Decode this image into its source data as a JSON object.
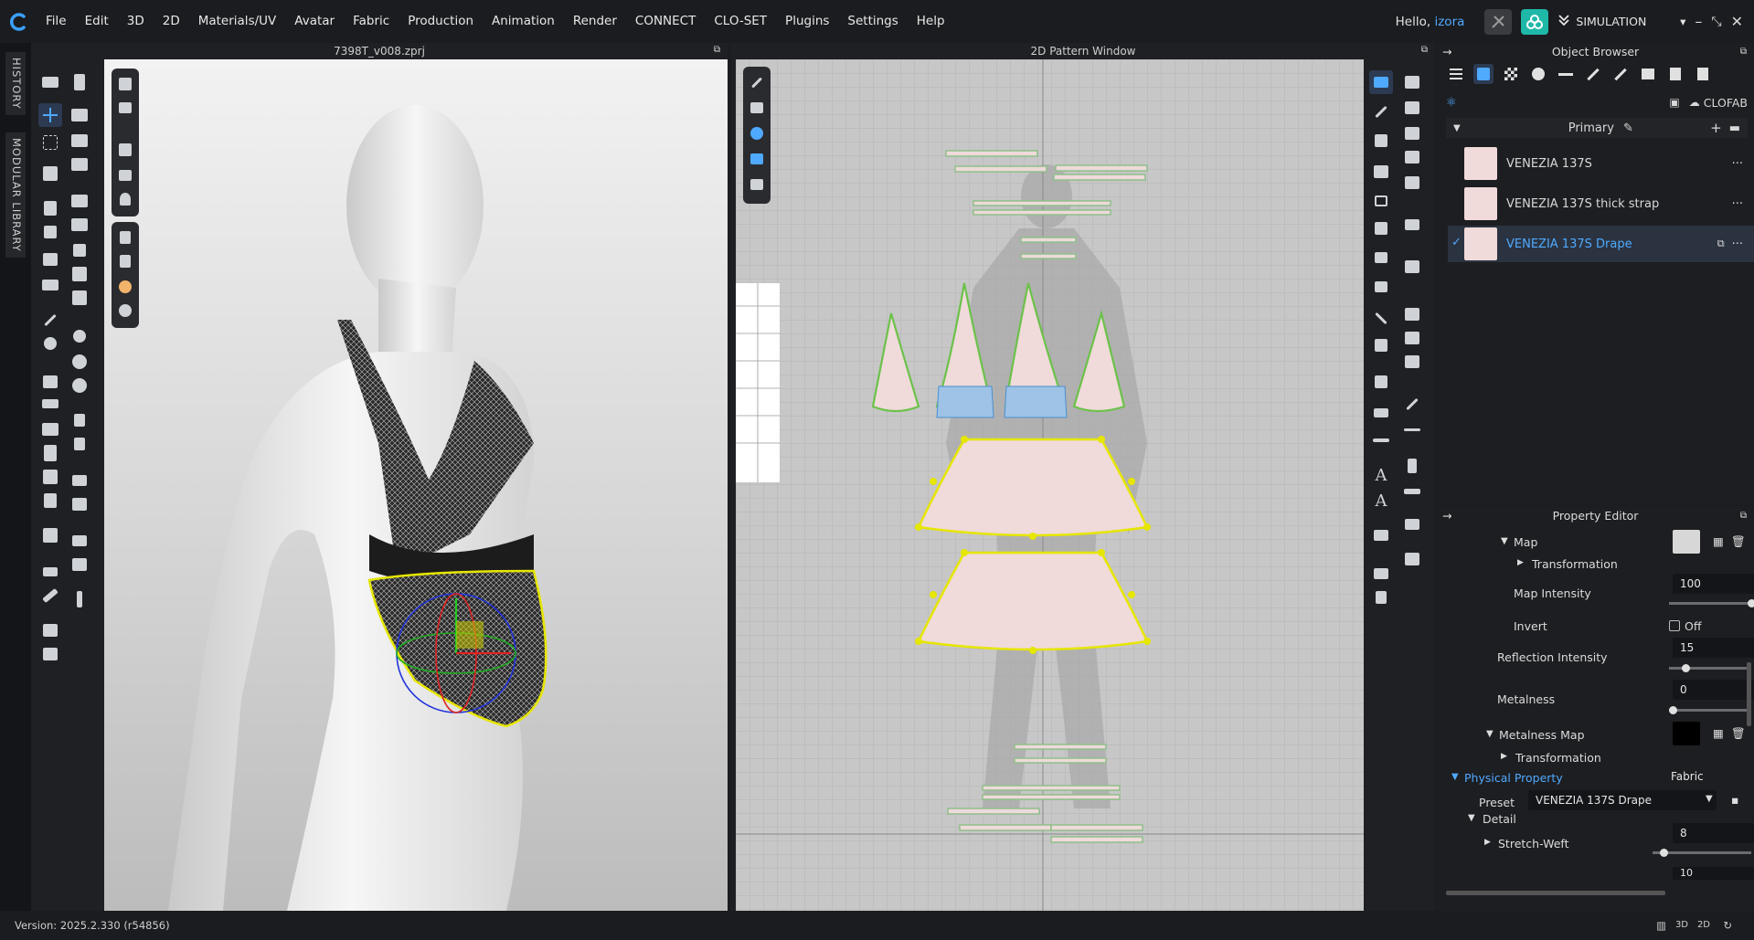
{
  "menubar": {
    "items": [
      "File",
      "Edit",
      "3D",
      "2D",
      "Materials/UV",
      "Avatar",
      "Fabric",
      "Production",
      "Animation",
      "Render",
      "CONNECT",
      "CLO-SET",
      "Plugins",
      "Settings",
      "Help"
    ],
    "greeting": "Hello,",
    "username": "izora",
    "mode_label": "SIMULATION"
  },
  "side_tabs": {
    "history": "HISTORY",
    "library": "MODULAR LIBRARY"
  },
  "panel3d": {
    "title": "7398T_v008.zprj"
  },
  "panel2d": {
    "title": "2D Pattern Window"
  },
  "object_browser": {
    "title": "Object Browser",
    "brand_label": "CLOFAB",
    "group_label": "Primary",
    "materials": [
      {
        "name": "VENEZIA 137S",
        "selected": false
      },
      {
        "name": "VENEZIA 137S thick strap",
        "selected": false
      },
      {
        "name": "VENEZIA 137S Drape",
        "selected": true
      }
    ]
  },
  "property_editor": {
    "title": "Property Editor",
    "map_label": "Map",
    "transformation_label": "Transformation",
    "map_intensity_label": "Map Intensity",
    "map_intensity_value": "100",
    "invert_label": "Invert",
    "invert_value": "Off",
    "reflection_label": "Reflection Intensity",
    "reflection_value": "15",
    "metalness_label": "Metalness",
    "metalness_value": "0",
    "metalness_map_label": "Metalness Map",
    "transformation2_label": "Transformation",
    "physical_label": "Physical Property",
    "physical_value": "Fabric",
    "preset_label": "Preset",
    "preset_value": "VENEZIA 137S Drape",
    "detail_label": "Detail",
    "stretch_weft_label": "Stretch-Weft",
    "stretch_weft_value": "8",
    "next_value": "10"
  },
  "status": {
    "version": "Version: 2025.2.330 (r54856)"
  },
  "colors": {
    "accent": "#4fa9ff",
    "fabric_fill": "#f0dada",
    "pattern_outline": "#6cc24a",
    "background": "#1c1d20"
  }
}
